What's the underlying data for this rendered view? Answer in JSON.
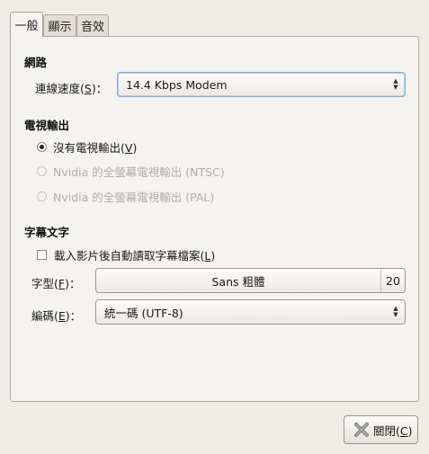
{
  "tabs": [
    {
      "label": "一般",
      "active": true
    },
    {
      "label": "顯示",
      "active": false
    },
    {
      "label": "音效",
      "active": false
    }
  ],
  "network": {
    "title": "網路",
    "speed_label": "連線速度(",
    "speed_mnemonic": "S",
    "speed_suffix": ")：",
    "speed_value": "14.4 Kbps Modem"
  },
  "tvout": {
    "title": "電視輸出",
    "options": [
      {
        "label": "沒有電視輸出(",
        "mnemonic": "V",
        "suffix": ")",
        "selected": true,
        "enabled": true
      },
      {
        "label": "Nvidia 的全螢幕電視輸出 (NTSC)",
        "selected": false,
        "enabled": false
      },
      {
        "label": "Nvidia 的全螢幕電視輸出 (PAL)",
        "selected": false,
        "enabled": false
      }
    ]
  },
  "subtitles": {
    "title": "字幕文字",
    "autoload_label": "載入影片後自動讀取字幕檔案(",
    "autoload_mnemonic": "L",
    "autoload_suffix": ")",
    "autoload_checked": false,
    "font_label": "字型(",
    "font_mnemonic": "F",
    "font_suffix": ")：",
    "font_name": "Sans 粗體",
    "font_size": "20",
    "encoding_label": "編碼(",
    "encoding_mnemonic": "E",
    "encoding_suffix": ")：",
    "encoding_value": "統一碼 (UTF-8)"
  },
  "buttons": {
    "close_label": "關閉(",
    "close_mnemonic": "C",
    "close_suffix": ")"
  },
  "colors": {
    "window_bg": "#efebe7",
    "panel_bg": "#f5f3f0",
    "focus_border": "#86a9d8",
    "disabled_text": "#b3ada6",
    "close_icon": "#7a7a7a"
  }
}
